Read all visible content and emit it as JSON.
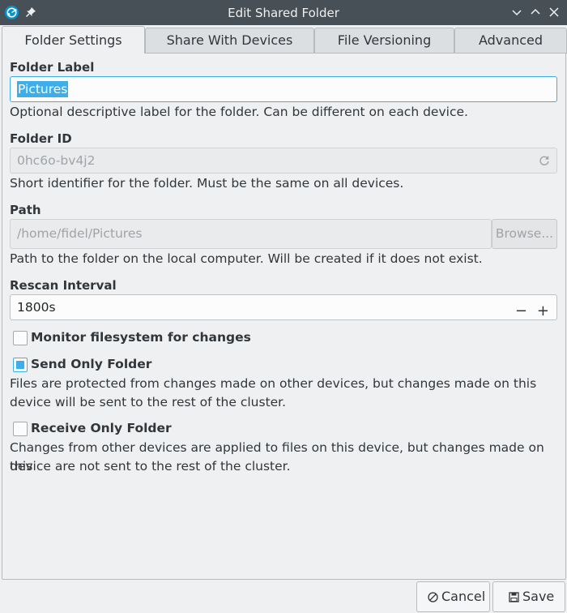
{
  "window": {
    "title": "Edit Shared Folder"
  },
  "tabs": [
    {
      "label": "Folder Settings",
      "active": true
    },
    {
      "label": "Share With Devices",
      "active": false
    },
    {
      "label": "File Versioning",
      "active": false
    },
    {
      "label": "Advanced",
      "active": false
    }
  ],
  "folder_label": {
    "label": "Folder Label",
    "value": "Pictures",
    "help": "Optional descriptive label for the folder. Can be different on each device."
  },
  "folder_id": {
    "label": "Folder ID",
    "value": "0hc6o-bv4j2",
    "help": "Short identifier for the folder. Must be the same on all devices."
  },
  "path": {
    "label": "Path",
    "value": "/home/fidel/Pictures",
    "browse_label": "Browse...",
    "help": "Path to the folder on the local computer. Will be created if it does not exist."
  },
  "rescan": {
    "label": "Rescan Interval",
    "value": "1800s",
    "minus": "−",
    "plus": "+"
  },
  "monitor": {
    "label": "Monitor filesystem for changes",
    "checked": false
  },
  "send_only": {
    "label": "Send Only Folder",
    "checked": true,
    "help_line1": "Files are protected from changes made on other devices, but changes made on this",
    "help_line2": "device will be sent to the rest of the cluster."
  },
  "receive_only": {
    "label": "Receive Only Folder",
    "checked": false,
    "help_line1": "Changes from other devices are applied to files on this device, but changes made on this",
    "help_line2": "device are not sent to the rest of the cluster."
  },
  "buttons": {
    "cancel": "Cancel",
    "save": "Save"
  },
  "colors": {
    "accent": "#3daee9",
    "titlebar": "#475057",
    "window_bg": "#eff0f1"
  }
}
